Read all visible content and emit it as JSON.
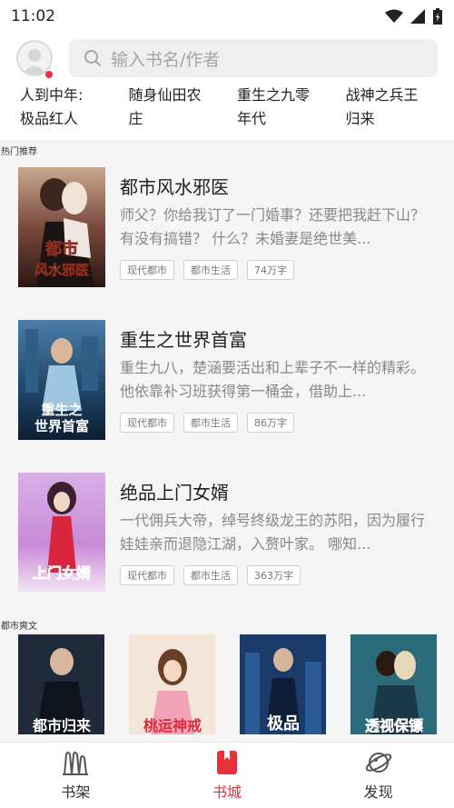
{
  "status": {
    "time": "11:02"
  },
  "header": {
    "search_placeholder": "输入书名/作者"
  },
  "categories": [
    {
      "line1": "人到中年:",
      "line2": "极品红人"
    },
    {
      "line1": "随身仙田农",
      "line2": "庄"
    },
    {
      "line1": "重生之九零",
      "line2": "年代"
    },
    {
      "line1": "战神之兵王",
      "line2": "归来"
    }
  ],
  "hot": {
    "title": "热门推荐",
    "books": [
      {
        "title": "都市风水邪医",
        "desc": "师父？你给我订了一门婚事？还要把我赶下山？有没有搞错？ 什么？未婚妻是绝世美...",
        "tags": [
          "现代都市",
          "都市生活",
          "74万字"
        ],
        "cover_text": "都市风水邪医"
      },
      {
        "title": "重生之世界首富",
        "desc": "重生九八，楚涵要活出和上辈子不一样的精彩。 他依靠补习班获得第一桶金，借助上...",
        "tags": [
          "现代都市",
          "都市生活",
          "86万字"
        ],
        "cover_text": "重生之世界首富"
      },
      {
        "title": "绝品上门女婿",
        "desc": "一代佣兵大帝，绰号终级龙王的苏阳，因为履行娃娃亲而退隐江湖，入赘叶家。 哪知...",
        "tags": [
          "现代都市",
          "都市生活",
          "363万字"
        ],
        "cover_text": "上门女婿"
      }
    ]
  },
  "urban": {
    "title": "都市爽文",
    "covers": [
      "都市归来",
      "桃运神戒",
      "极品",
      "透视保镖"
    ]
  },
  "nav": [
    {
      "label": "书架",
      "icon": "bookshelf-icon"
    },
    {
      "label": "书城",
      "icon": "bookstore-icon"
    },
    {
      "label": "发现",
      "icon": "planet-icon"
    }
  ],
  "colors": {
    "accent": "#e8323c"
  }
}
